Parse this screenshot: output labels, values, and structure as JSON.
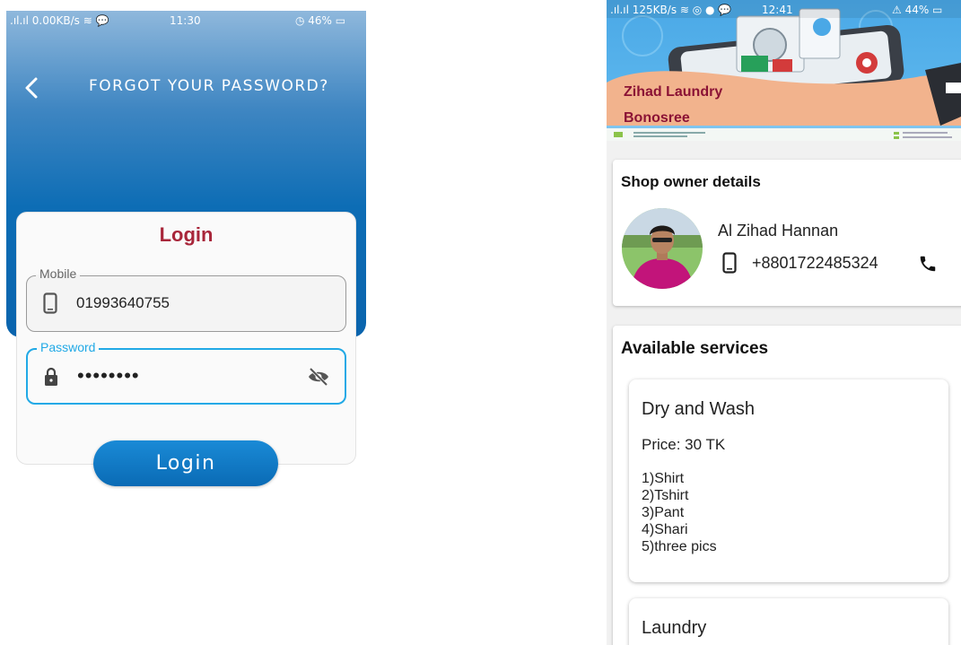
{
  "login_screen": {
    "status_bar": {
      "left": ".ıl.ıl 0.00KB/s ≋ 💬",
      "time": "11:30",
      "right": "◷ 46% ▭"
    },
    "header": {
      "title": "FORGOT YOUR PASSWORD?",
      "back_icon": "chevron-left-icon"
    },
    "card": {
      "title": "Login",
      "mobile": {
        "label": "Mobile",
        "value": "01993640755",
        "icon": "phone-icon"
      },
      "password": {
        "label": "Password",
        "value": "••••••••",
        "icon": "lock-icon",
        "toggle_icon": "eye-off-icon"
      }
    },
    "login_button": "Login",
    "colors": {
      "title_red": "#a8263a",
      "accent_blue": "#21a9e6",
      "header_blue": "#0a64ad"
    }
  },
  "shop_screen": {
    "status_bar": {
      "left": ".ıl.ıl 125KB/s ≋ ◎ ● 💬",
      "time": "12:41",
      "right": "⚠ 44% ▭"
    },
    "banner": {
      "shop_name": "Zihad Laundry",
      "area": "Bonosree"
    },
    "owner_section": {
      "heading": "Shop owner details",
      "name": "Al Zihad Hannan",
      "phone": "+8801722485324",
      "phone_icon": "phone-icon",
      "call_icon": "call-icon"
    },
    "services_section": {
      "heading": "Available services",
      "services": [
        {
          "name": "Dry and Wash",
          "price": "Price:  30 TK",
          "items": [
            "1)Shirt",
            "2)Tshirt",
            "3)Pant",
            "4)Shari",
            "5)three pics"
          ]
        },
        {
          "name": "Laundry"
        }
      ]
    },
    "colors": {
      "banner_text": "#8b1235",
      "background": "#f1f1f1"
    }
  }
}
